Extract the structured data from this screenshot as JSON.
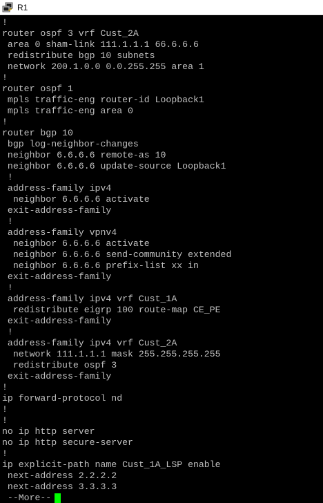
{
  "window": {
    "title": "R1",
    "icon": "putty-icon"
  },
  "terminal": {
    "lines": [
      "!",
      "router ospf 3 vrf Cust_2A",
      " area 0 sham-link 111.1.1.1 66.6.6.6",
      " redistribute bgp 10 subnets",
      " network 200.1.0.0 0.0.255.255 area 1",
      "!",
      "router ospf 1",
      " mpls traffic-eng router-id Loopback1",
      " mpls traffic-eng area 0",
      "!",
      "router bgp 10",
      " bgp log-neighbor-changes",
      " neighbor 6.6.6.6 remote-as 10",
      " neighbor 6.6.6.6 update-source Loopback1",
      " !",
      " address-family ipv4",
      "  neighbor 6.6.6.6 activate",
      " exit-address-family",
      " !",
      " address-family vpnv4",
      "  neighbor 6.6.6.6 activate",
      "  neighbor 6.6.6.6 send-community extended",
      "  neighbor 6.6.6.6 prefix-list xx in",
      " exit-address-family",
      " !",
      " address-family ipv4 vrf Cust_1A",
      "  redistribute eigrp 100 route-map CE_PE",
      " exit-address-family",
      " !",
      " address-family ipv4 vrf Cust_2A",
      "  network 111.1.1.1 mask 255.255.255.255",
      "  redistribute ospf 3",
      " exit-address-family",
      "!",
      "ip forward-protocol nd",
      "!",
      "!",
      "no ip http server",
      "no ip http secure-server",
      "!",
      "ip explicit-path name Cust_1A_LSP enable",
      " next-address 2.2.2.2",
      " next-address 3.3.3.3"
    ],
    "more_prompt": " --More--",
    "cursor_color": "#00ff00",
    "text_color": "#c0c0c0",
    "background_color": "#000000"
  }
}
